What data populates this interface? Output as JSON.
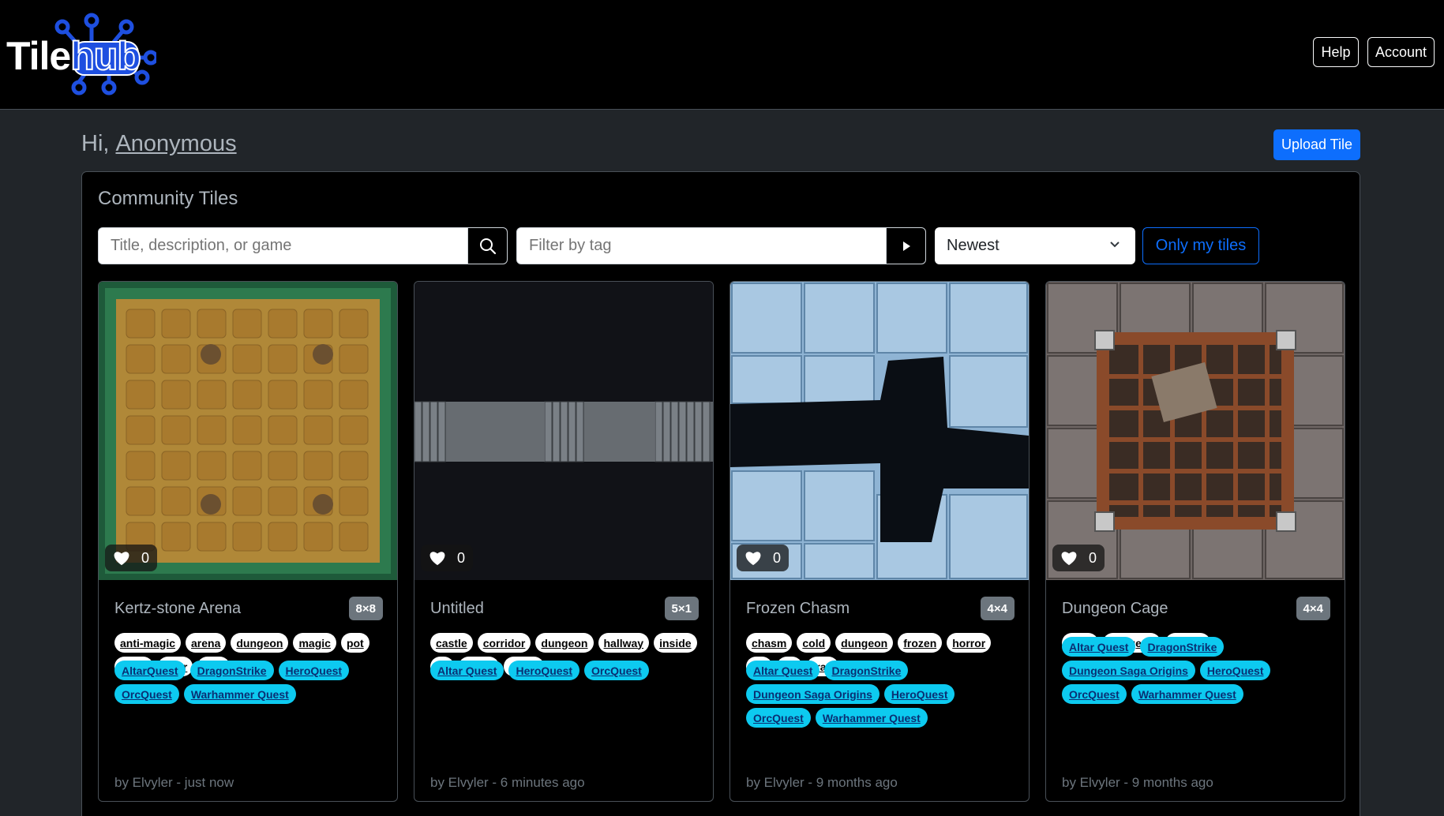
{
  "brand": {
    "part1": "Tile",
    "part2": "hub"
  },
  "nav": {
    "help": "Help",
    "account": "Account"
  },
  "greeting": {
    "hi": "Hi,",
    "user": "Anonymous"
  },
  "upload": "Upload Tile",
  "panel": {
    "title": "Community Tiles",
    "search_placeholder": "Title, description, or game",
    "tag_placeholder": "Filter by tag",
    "sort_value": "Newest",
    "only_mine": "Only my tiles"
  },
  "icons": {
    "search": "search-icon",
    "submit": "play-arrow-icon",
    "chevron": "chevron-down-icon",
    "heart": "heart-icon"
  },
  "colors": {
    "accent": "#0d6efd",
    "game_tag": "#0dcaf0",
    "badge": "#6c757d"
  },
  "cards": [
    {
      "likes": "0",
      "title": "Kertz-stone Arena",
      "size": "8×8",
      "tags": [
        "anti-magic",
        "arena",
        "dungeon",
        "magic",
        "pot",
        "room",
        "telor",
        "trap"
      ],
      "games": [
        "AltarQuest",
        "DragonStrike",
        "HeroQuest",
        "OrcQuest",
        "Warhammer Quest"
      ],
      "byline": "by Elvyler - just now"
    },
    {
      "likes": "0",
      "title": "Untitled",
      "size": "5×1",
      "tags": [
        "castle",
        "corridor",
        "dungeon",
        "hallway",
        "inside",
        "kk",
        "stairs",
        "stone"
      ],
      "games": [
        "Altar Quest",
        "HeroQuest",
        "OrcQuest"
      ],
      "byline": "by Elvyler - 6 minutes ago"
    },
    {
      "likes": "0",
      "title": "Frozen Chasm",
      "size": "4×4",
      "tags": [
        "chasm",
        "cold",
        "dungeon",
        "frozen",
        "horror",
        "icy",
        "pit",
        "trap"
      ],
      "games": [
        "Altar Quest",
        "DragonStrike",
        "Dungeon Saga Origins",
        "HeroQuest",
        "OrcQuest",
        "Warhammer Quest"
      ],
      "byline": "by Elvyler - 9 months ago"
    },
    {
      "likes": "0",
      "title": "Dungeon Cage",
      "size": "4×4",
      "tags": [
        "cage",
        "dungeon",
        "prison"
      ],
      "games": [
        "Altar Quest",
        "DragonStrike",
        "Dungeon Saga Origins",
        "HeroQuest",
        "OrcQuest",
        "Warhammer Quest"
      ],
      "byline": "by Elvyler - 9 months ago"
    }
  ]
}
